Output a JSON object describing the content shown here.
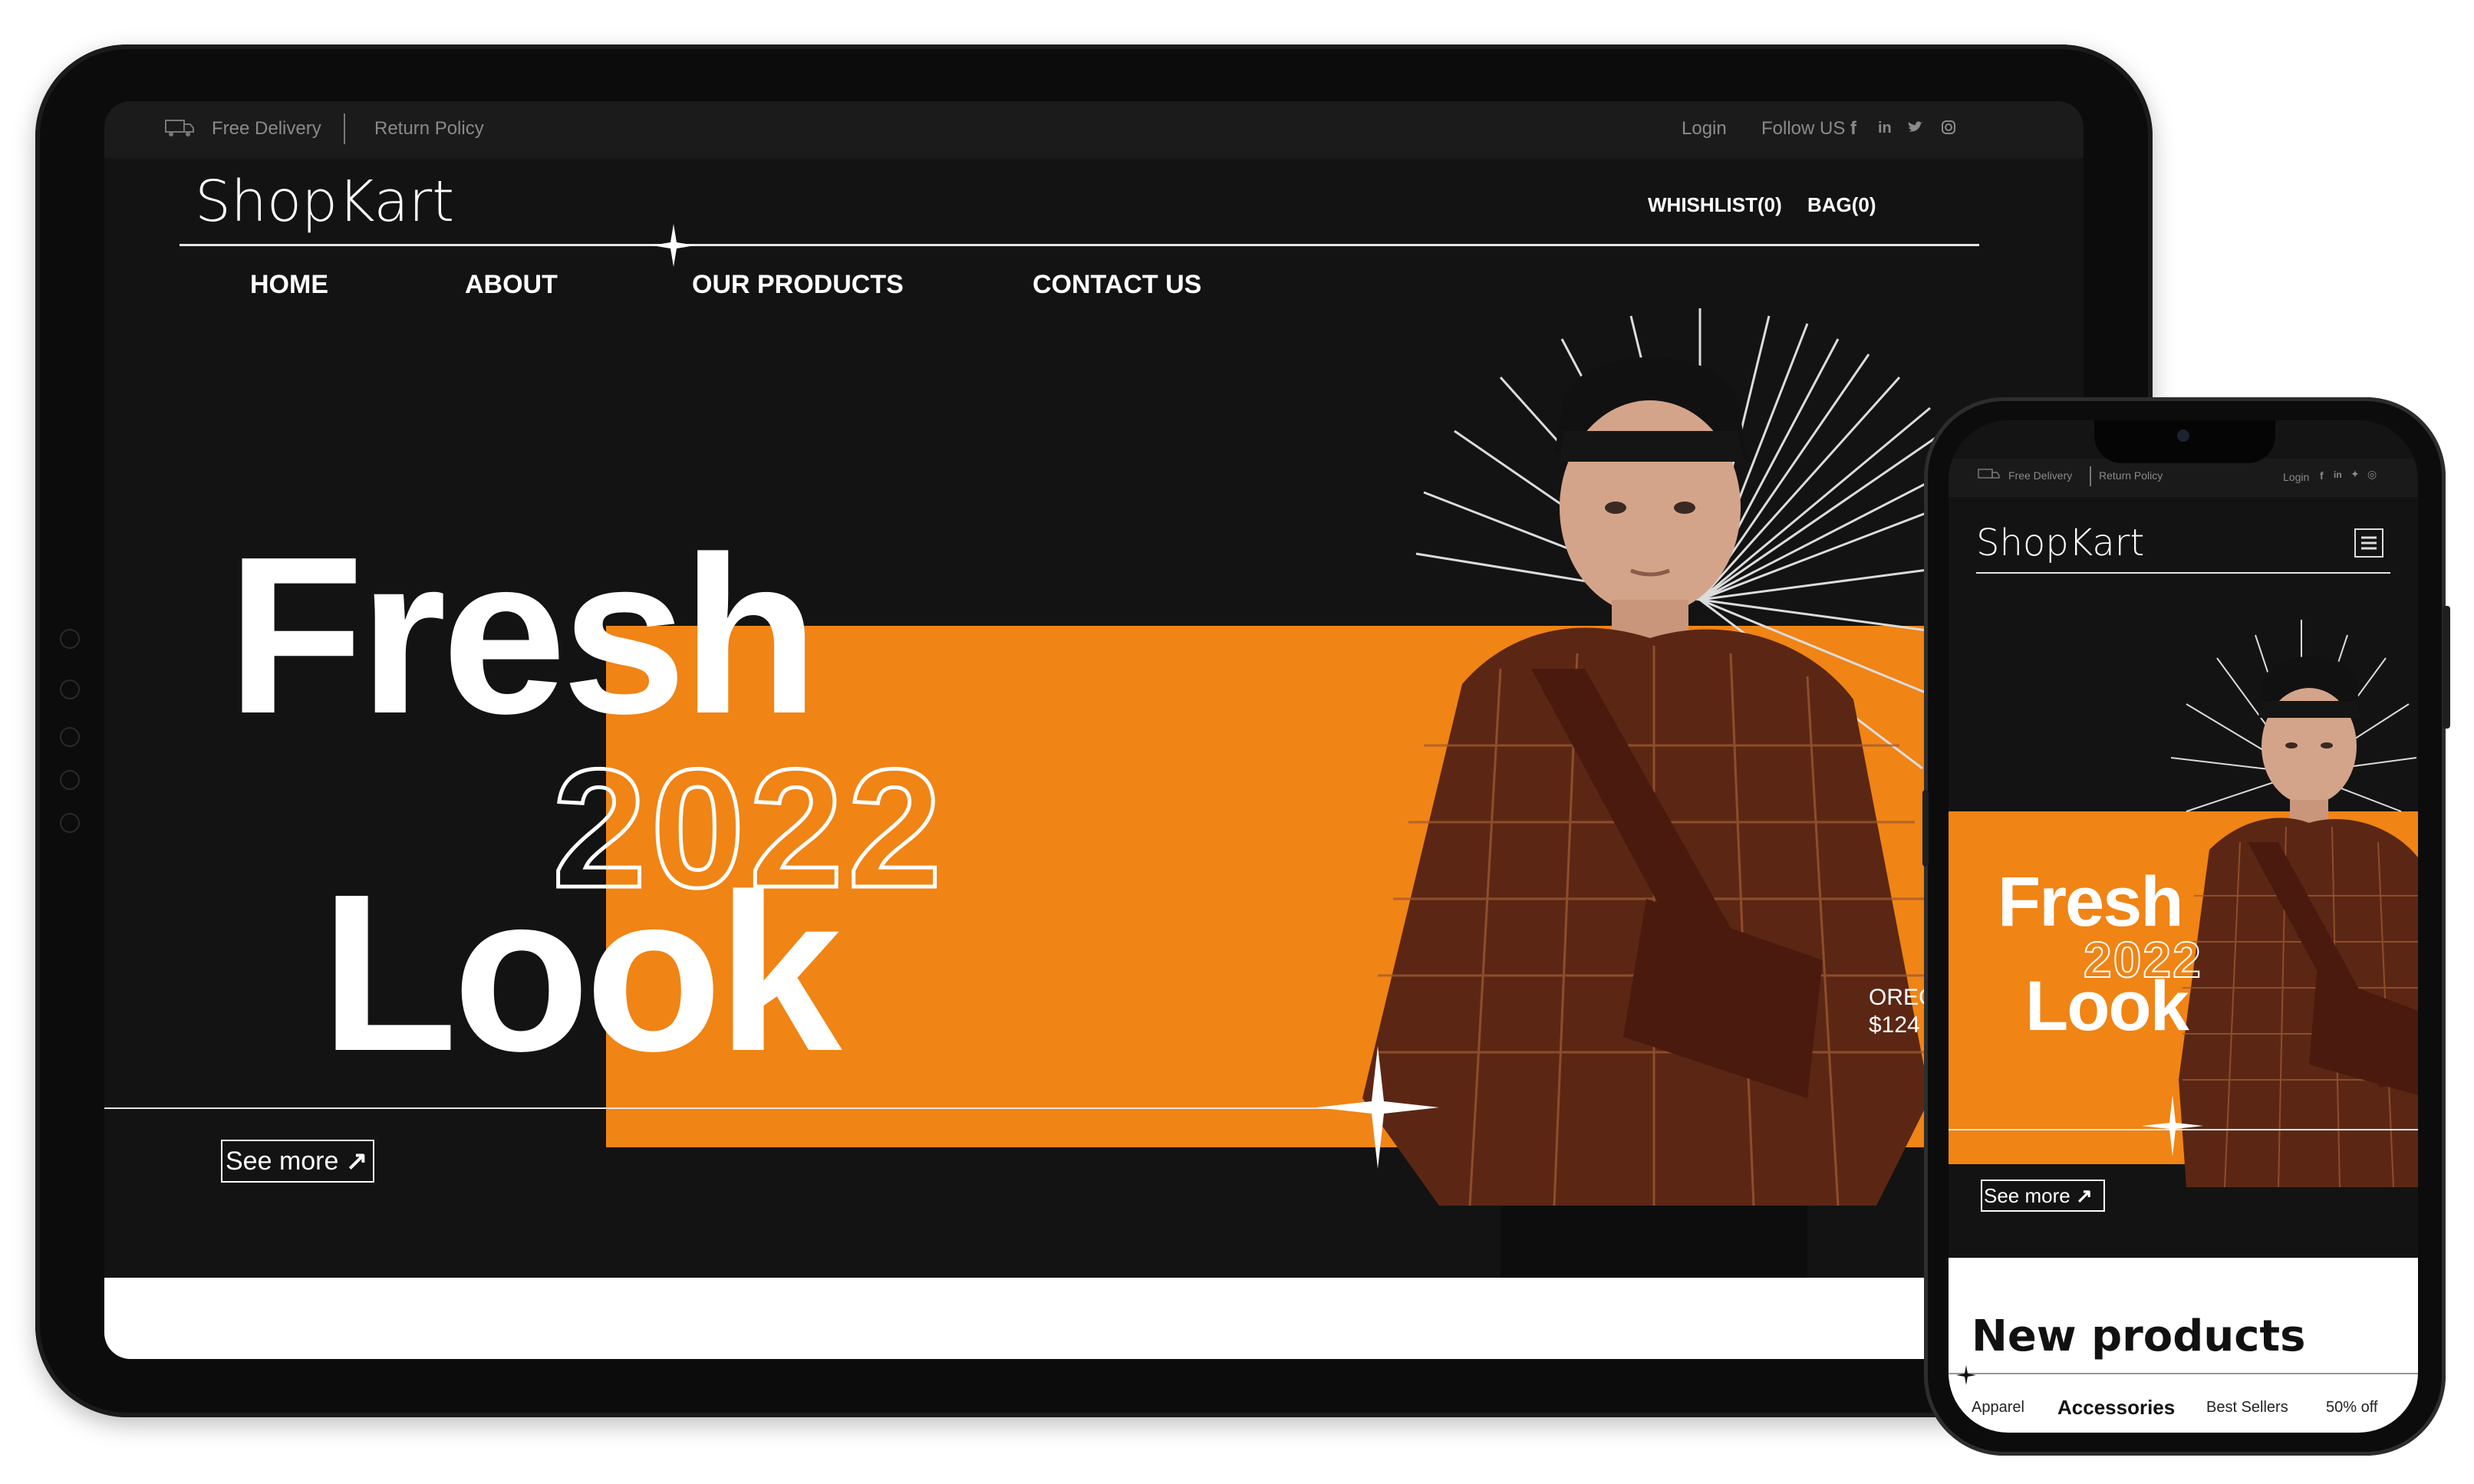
{
  "topbar": {
    "free_delivery": "Free Delivery",
    "return_policy": "Return Policy",
    "login": "Login",
    "follow_us": "Follow US",
    "social": [
      "facebook-icon",
      "linkedin-icon",
      "twitter-icon",
      "instagram-icon"
    ]
  },
  "header": {
    "logo": "ShopKart",
    "wishlist": "WHISHLIST(0)",
    "bag": "BAG(0)"
  },
  "nav": [
    "HOME",
    "ABOUT",
    "OUR PRODUCTS",
    "CONTACT US"
  ],
  "hero": {
    "line1": "Fresh",
    "line2": "2022",
    "line3": "Look",
    "see_more": "See more",
    "product_name": "OREG",
    "product_price": "$124",
    "accent_color": "#f08415"
  },
  "phone": {
    "topbar": {
      "free_delivery": "Free Delivery",
      "return_policy": "Return Policy",
      "login": "Login"
    },
    "logo": "ShopKart",
    "hero": {
      "line1": "Fresh",
      "line2": "2022",
      "line3": "Look",
      "see_more": "See more"
    },
    "section_title": "New products",
    "tabs": [
      "Apparel",
      "Accessories",
      "Best Sellers",
      "50% off"
    ]
  }
}
